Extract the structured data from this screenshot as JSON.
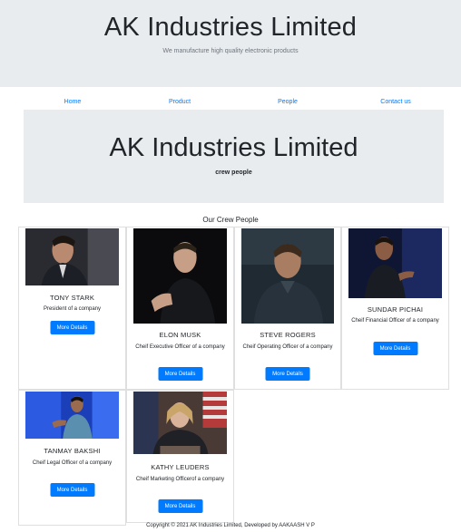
{
  "header": {
    "title": "AK Industries Limited",
    "tagline": "We manufacture high quality electronic products"
  },
  "nav": {
    "items": [
      {
        "label": "Home"
      },
      {
        "label": "Product"
      },
      {
        "label": "People"
      },
      {
        "label": "Contact us"
      }
    ]
  },
  "jumbotron": {
    "title": "AK Industries Limited",
    "subtitle": "crew people"
  },
  "crew": {
    "heading": "Our Crew People",
    "button_label": "More Details",
    "members": [
      {
        "name": "TONY STARK",
        "role": "President of a company"
      },
      {
        "name": "ELON MUSK",
        "role": "Cheif Executive Officer of a company"
      },
      {
        "name": "STEVE ROGERS",
        "role": "Cheif Operating Officer of a company"
      },
      {
        "name": "SUNDAR PICHAI",
        "role": "Cheif Financial Officer of a company"
      },
      {
        "name": "TANMAY BAKSHI",
        "role": "Cheif Legal Officer of a company"
      },
      {
        "name": "KATHY LEUDERS",
        "role": "Cheif Marketing Officerof a company"
      }
    ]
  },
  "footer": {
    "text": "Copyright © 2021 AK Industries Limited, Developed by AAKAASH V P"
  },
  "colors": {
    "jumbotron_bg": "#e9ecef",
    "link": "#007bff",
    "button": "#007bff"
  }
}
